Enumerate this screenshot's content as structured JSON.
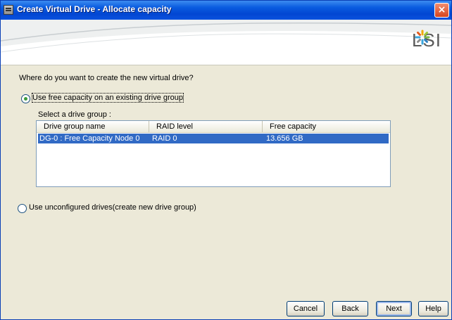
{
  "window": {
    "title": "Create Virtual Drive - Allocate capacity",
    "close_symbol": "×"
  },
  "banner": {
    "logo_text": "LSI"
  },
  "question": "Where do you want to create the new virtual drive?",
  "options": [
    {
      "label": "Use free capacity on an existing drive group",
      "selected": true
    },
    {
      "label": "Use unconfigured drives(create new drive group)",
      "selected": false
    }
  ],
  "drive_group_label": "Select a drive group :",
  "table": {
    "columns": [
      "Drive group name",
      "RAID level",
      "Free capacity"
    ],
    "rows": [
      {
        "name": "DG-0 : Free Capacity Node 0",
        "raid": "RAID 0",
        "capacity": "13.656 GB",
        "selected": true
      }
    ]
  },
  "buttons": {
    "cancel": "Cancel",
    "back": "Back",
    "next": "Next",
    "help": "Help"
  },
  "colors": {
    "title_bar": "#0a52de",
    "selection": "#316ac5",
    "dialog_bg": "#ece9d8"
  }
}
